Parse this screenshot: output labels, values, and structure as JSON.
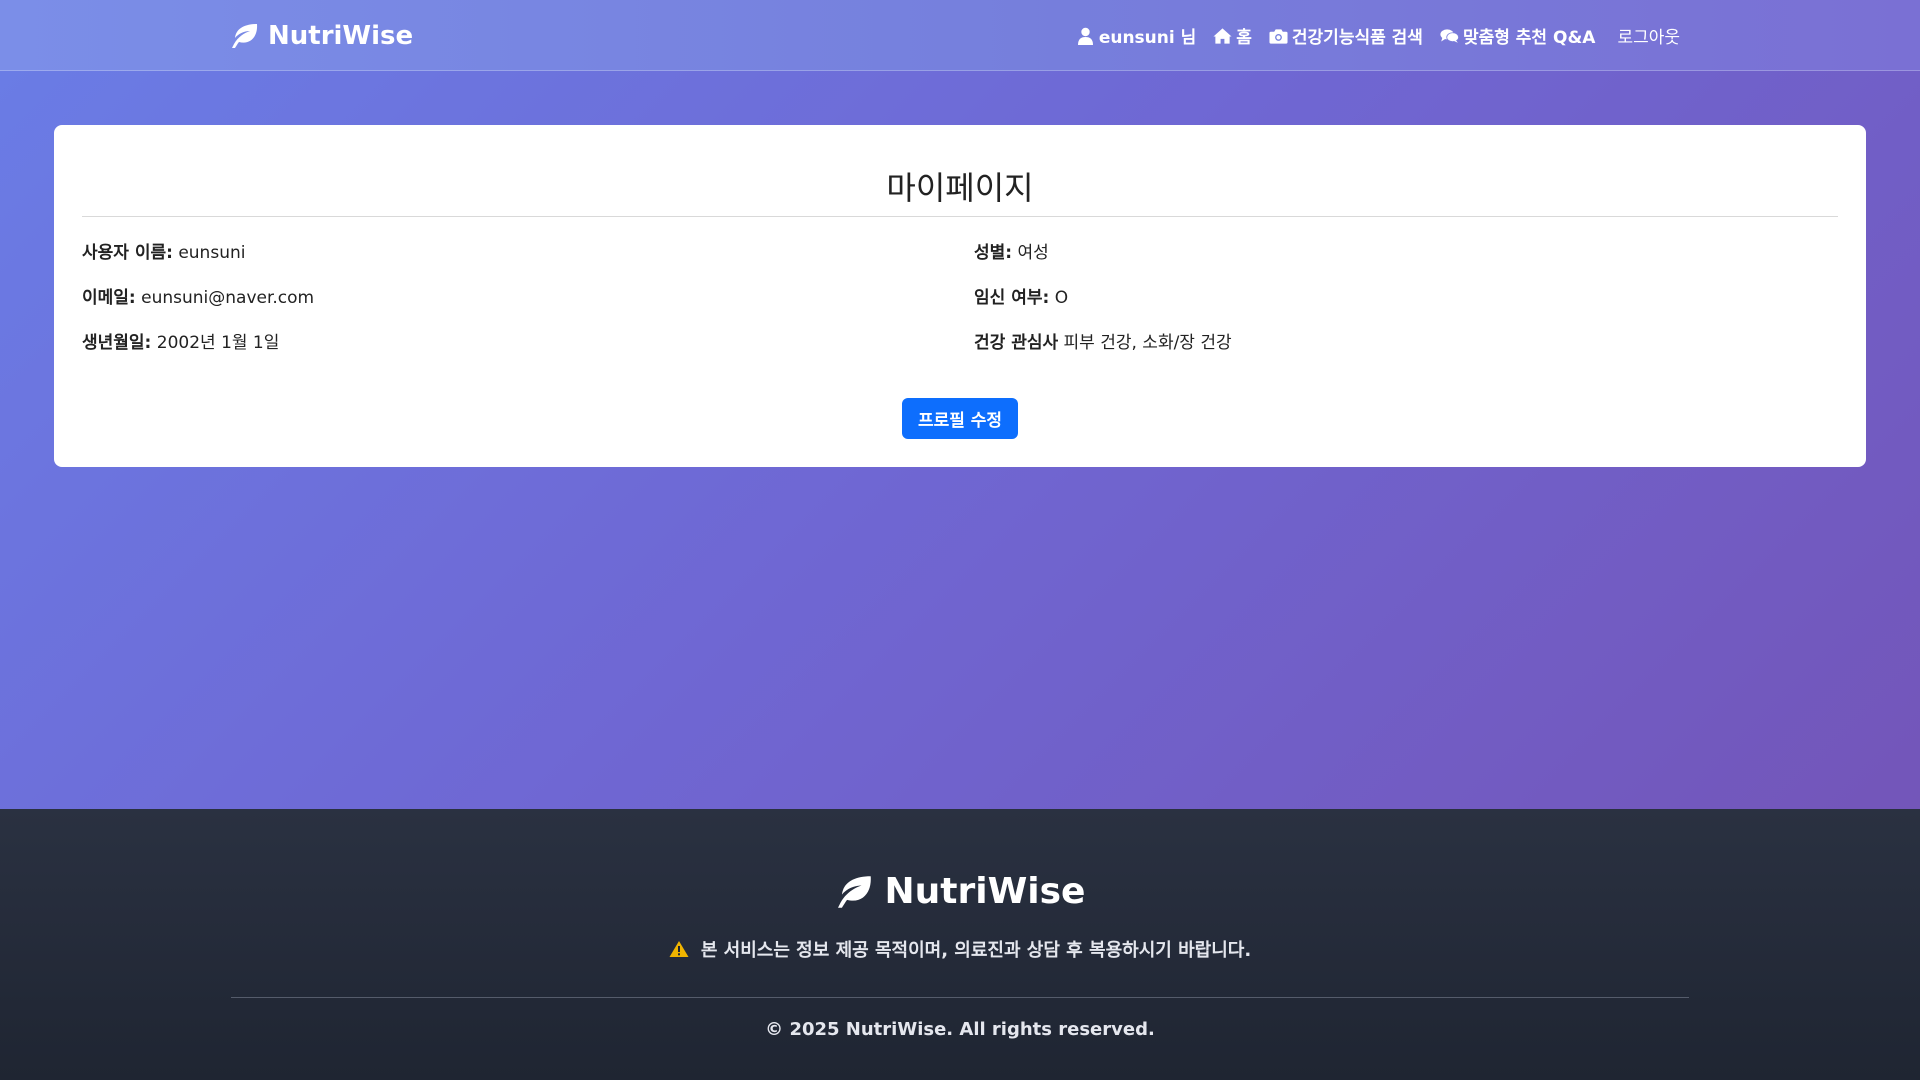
{
  "header": {
    "brand": "NutriWise",
    "nav": {
      "user": "eunsuni 님",
      "home": "홈",
      "search": "건강기능식품 검색",
      "qa": "맞춤형 추천 Q&A",
      "logout": "로그아웃"
    },
    "icons": [
      "leaf-icon",
      "user-icon",
      "home-icon",
      "camera-icon",
      "comments-icon"
    ]
  },
  "profile": {
    "title": "마이페이지",
    "fields": {
      "username": {
        "label": "사용자 이름:",
        "value": "eunsuni"
      },
      "email": {
        "label": "이메일:",
        "value": "eunsuni@naver.com"
      },
      "birthdate": {
        "label": "생년월일:",
        "value": "2002년 1월 1일"
      },
      "gender": {
        "label": "성별:",
        "value": "여성"
      },
      "pregnancy": {
        "label": "임신 여부:",
        "value": "O"
      },
      "interests": {
        "label": "건강 관심사",
        "value": "피부 건강, 소화/장 건강"
      }
    },
    "edit_button": "프로필 수정"
  },
  "footer": {
    "brand": "NutriWise",
    "disclaimer": "본 서비스는 정보 제공 목적이며, 의료진과 상담 후 복용하시기 바랍니다.",
    "copyright": "© 2025 NutriWise. All rights reserved."
  },
  "colors": {
    "primary_button": "#0d6efd",
    "footer_bg": "#232a38",
    "warning": "#f0b400"
  }
}
